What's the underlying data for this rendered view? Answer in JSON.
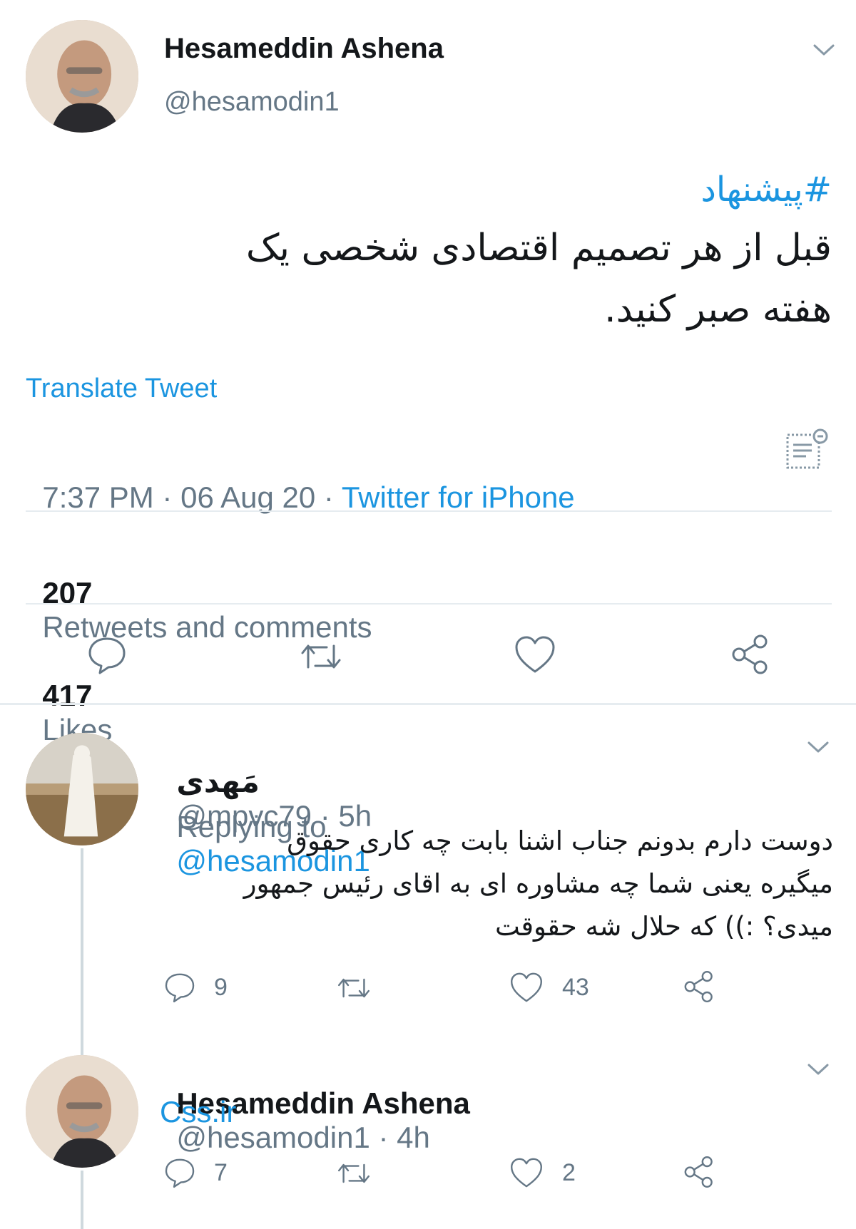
{
  "main_tweet": {
    "author_name": "Hesameddin Ashena",
    "handle": "@hesamodin1",
    "hashtag": "#پیشنهاد",
    "text_line1": "قبل از هر تصمیم اقتصادی شخصی یک",
    "text_line2": "هفته صبر کنید.",
    "translate": "Translate Tweet",
    "time_date": "7:37 PM · 06 Aug 20 · ",
    "source": "Twitter for iPhone",
    "retweets_count": "207",
    "retweets_label": "Retweets and comments",
    "likes_count": "417",
    "likes_label": "Likes"
  },
  "reply1": {
    "author_name": "مَهدی",
    "handle_time": "@mpvc79 · 5h",
    "replying_label": "Replying to",
    "replying_handle": "@hesamodin1",
    "text_line1": "دوست دارم بدونم جناب اشنا بابت چه کاری حقوق",
    "text_line2": "میگیره یعنی شما چه مشاوره ای به اقای رئیس جمهور",
    "text_line3": "میدی؟ :)) که حلال شه حقوقت",
    "reply_count": "9",
    "like_count": "43"
  },
  "reply2": {
    "author_name": "Hesameddin Ashena",
    "handle_time": "@hesamodin1 · 4h",
    "text": "Css.ir",
    "reply_count": "7",
    "like_count": "2"
  },
  "colors": {
    "link": "#1b95e0",
    "muted": "#657786",
    "divider": "#e6ecf0"
  },
  "icons": [
    "chevron-down-icon",
    "reply-icon",
    "retweet-icon",
    "like-icon",
    "share-icon",
    "analytics-icon"
  ]
}
